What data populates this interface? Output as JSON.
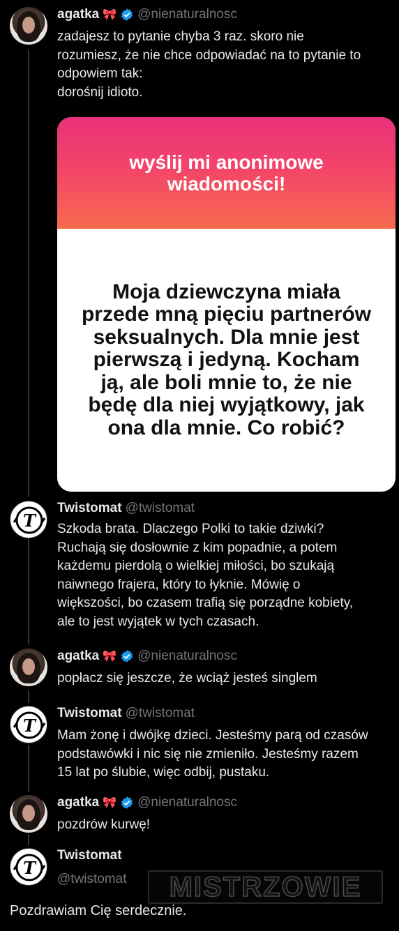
{
  "posts": [
    {
      "author": "agatka",
      "author_emoji": "🎀",
      "verified": true,
      "handle": "@nienaturalnosc",
      "text_lines": [
        "zadajesz to pytanie chyba 3 raz. skoro nie",
        "rozumiesz, że nie chce odpowiadać na to pytanie to",
        "odpowiem tak:",
        "dorośnij idioto."
      ],
      "card": {
        "title": "wyślij mi anonimowe wiadomości!",
        "message": "Moja dziewczyna miała przede mną pięciu partnerów seksualnych. Dla mnie jest pierwszą i jedyną. Kocham ją, ale boli mnie to, że nie będę dla niej wyjątkowy, jak ona dla mnie. Co robić?"
      }
    },
    {
      "author": "Twistomat",
      "handle": "@twistomat",
      "text_lines": [
        "Szkoda brata. Dlaczego Polki to takie dziwki?",
        "Ruchają się dosłownie z kim popadnie, a potem",
        "każdemu pierdolą o wielkiej miłości, bo szukają",
        "naiwnego frajera, który to łyknie. Mówię o",
        "większości, bo czasem trafią się porządne kobiety,",
        "ale to jest wyjątek w tych czasach."
      ]
    },
    {
      "author": "agatka",
      "author_emoji": "🎀",
      "verified": true,
      "handle": "@nienaturalnosc",
      "text_lines": [
        "popłacz się jeszcze, że wciąż jesteś singlem"
      ]
    },
    {
      "author": "Twistomat",
      "handle": "@twistomat",
      "text_lines": [
        "Mam żonę i dwójkę dzieci. Jesteśmy parą od czasów",
        "podstawówki i nic się nie zmieniło. Jesteśmy razem",
        "15 lat po ślubie, więc odbij, pustaku."
      ]
    },
    {
      "author": "agatka",
      "author_emoji": "🎀",
      "verified": true,
      "handle": "@nienaturalnosc",
      "text_lines": [
        "pozdrów kurwę!"
      ]
    },
    {
      "author": "Twistomat",
      "handle": "@twistomat",
      "text": "Pozdrawiam Cię serdecznie."
    }
  ],
  "watermark": "MISTRZOWIE",
  "colors": {
    "background": "#000000",
    "text": "#e7e9ea",
    "secondary": "#71767b",
    "verified": "#1d9bf0",
    "thread_line": "#333639"
  }
}
